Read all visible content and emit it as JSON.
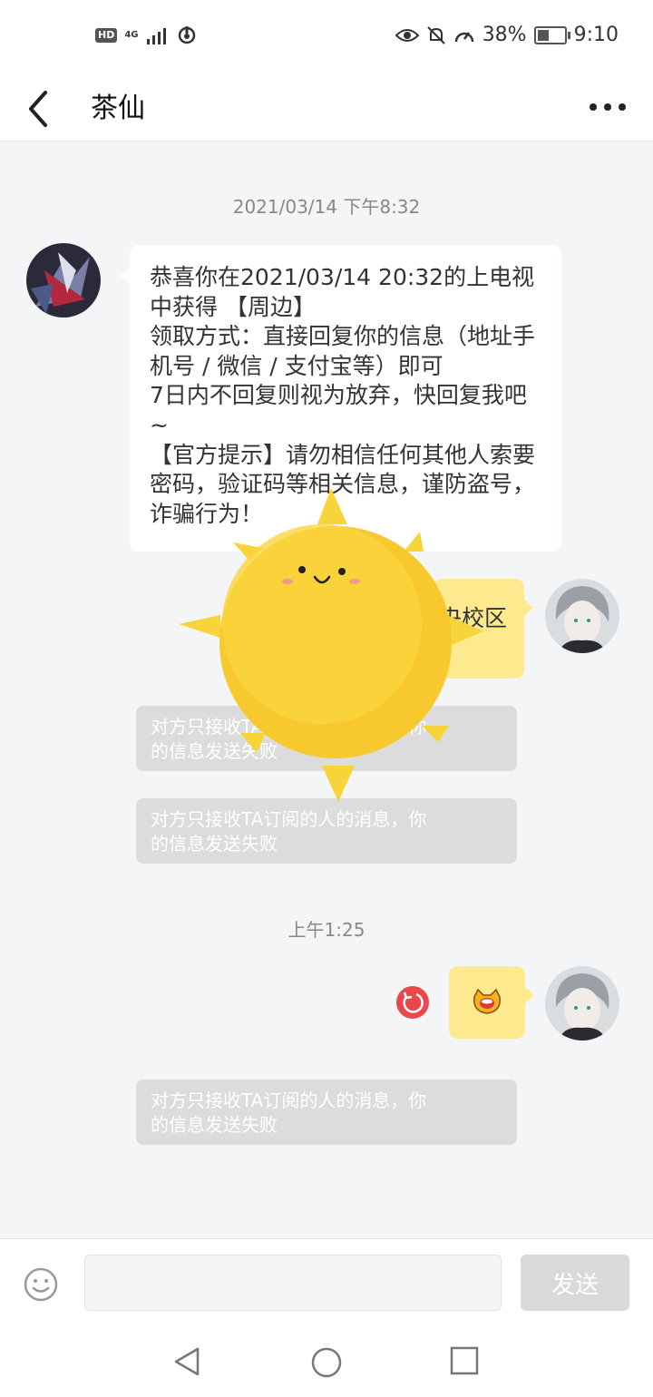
{
  "status_bar": {
    "hd_label": "HD",
    "network_label": "4G",
    "battery_percent": "38%",
    "time": "9:10"
  },
  "header": {
    "title": "茶仙"
  },
  "messages": {
    "timestamp_1": "2021/03/14 下午8:32",
    "incoming_text": "恭喜你在2021/03/14 20:32的上电视中获得 【周边】\n领取方式：直接回复你的信息（地址手机号 / 微信 / 支付宝等）即可\n7日内不回复则视为放弃，快回复我吧~\n【官方提示】请勿相信任何其他人索要密码，验证码等相关信息，谨防盗号，诈骗行为！",
    "outgoing_partial_text": "央校区",
    "system_note_1": "对方只接收TA订阅的人的消息，你\n的信息发送失败",
    "system_note_2": "对方只接收TA订阅的人的消息，你\n的信息发送失败",
    "timestamp_2": "上午1:25",
    "outgoing_sticker": "cat-face-sticker",
    "system_note_3": "对方只接收TA订阅的人的消息，你\n的信息发送失败"
  },
  "input_bar": {
    "placeholder": "",
    "send_label": "发送"
  },
  "colors": {
    "outgoing_bubble": "#fde98e",
    "incoming_bubble": "#ffffff",
    "retry_red": "#e8484b",
    "system_note_bg": "#dcdcdc",
    "chat_bg": "#f4f5f7"
  }
}
